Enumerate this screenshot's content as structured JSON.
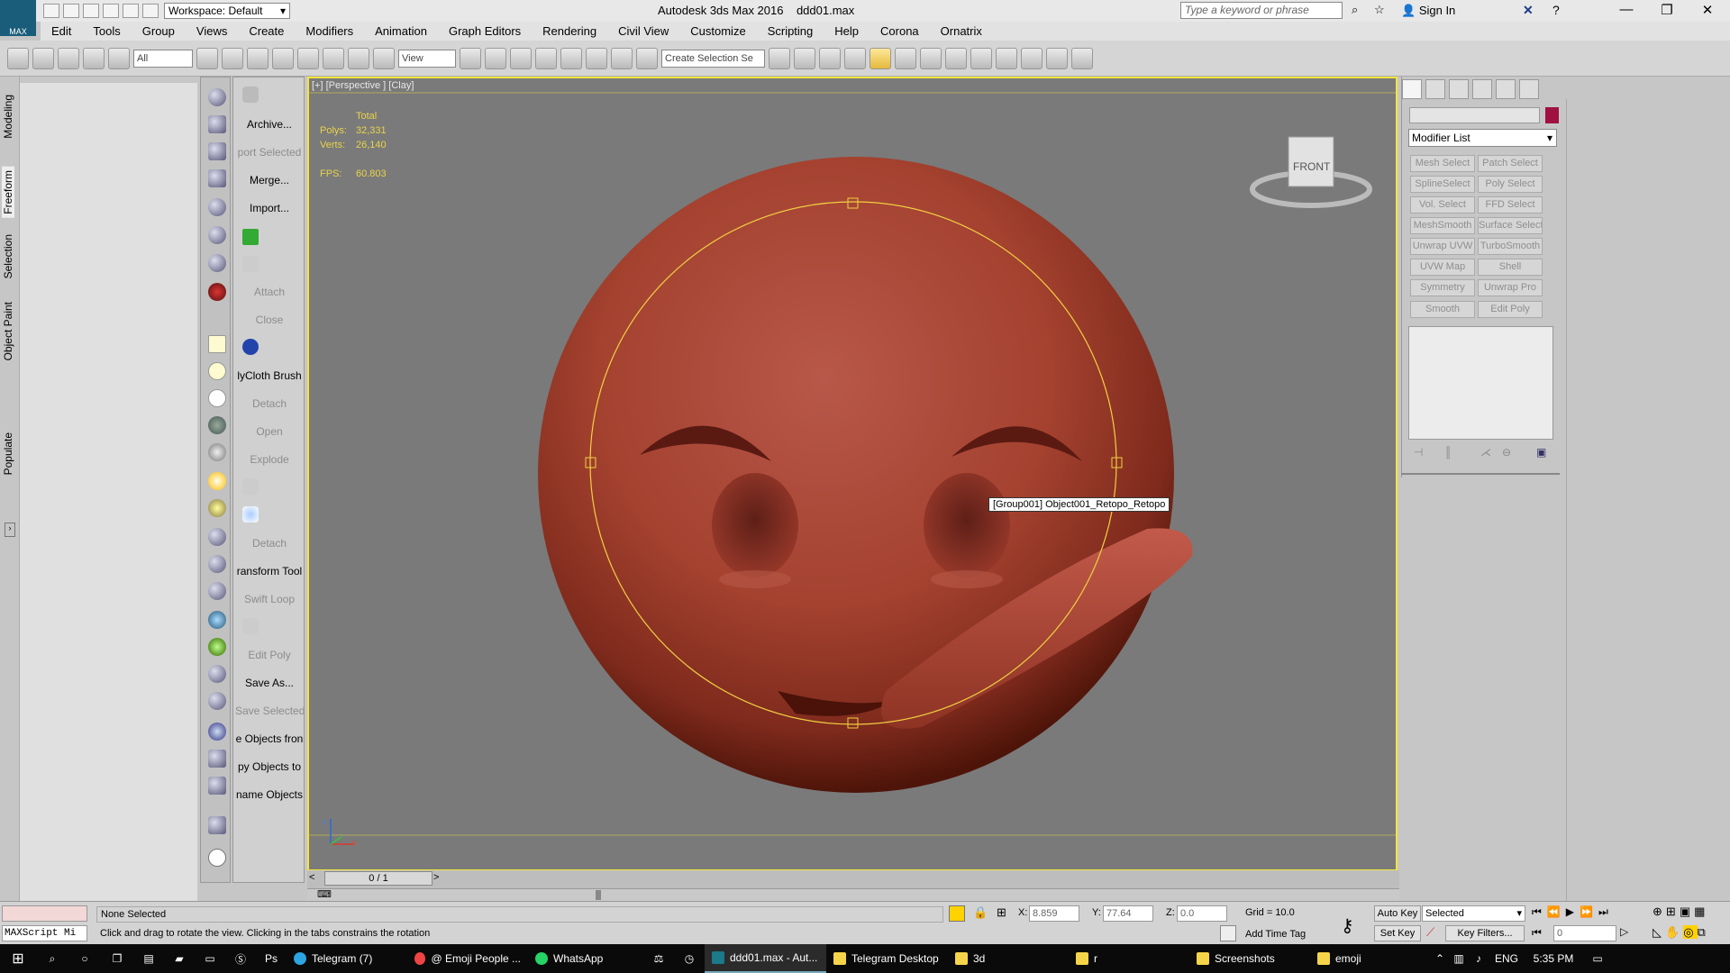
{
  "titlebar": {
    "app_title": "Autodesk 3ds Max 2016",
    "file_name": "ddd01.max",
    "workspace": "Workspace: Default",
    "search_placeholder": "Type a keyword or phrase",
    "sign_in": "Sign In",
    "logo_text": "MAX"
  },
  "menu": [
    "Edit",
    "Tools",
    "Group",
    "Views",
    "Create",
    "Modifiers",
    "Animation",
    "Graph Editors",
    "Rendering",
    "Civil View",
    "Customize",
    "Scripting",
    "Help",
    "Corona",
    "Ornatrix"
  ],
  "toolbar": {
    "filter": "All",
    "ref_coord": "View",
    "selection_set_placeholder": "Create Selection Se"
  },
  "left_tabs": [
    "Modeling",
    "Freeform",
    "Selection",
    "Object Paint",
    "Populate"
  ],
  "commands": [
    {
      "label": "Archive...",
      "enabled": true
    },
    {
      "label": "port Selected",
      "enabled": false
    },
    {
      "label": "Merge...",
      "enabled": true
    },
    {
      "label": "Import...",
      "enabled": true
    },
    {
      "label": "Attach",
      "enabled": false
    },
    {
      "label": "Close",
      "enabled": false
    },
    {
      "label": "lyCloth Brush",
      "enabled": true
    },
    {
      "label": "Detach",
      "enabled": false
    },
    {
      "label": "Open",
      "enabled": false
    },
    {
      "label": "Explode",
      "enabled": false
    },
    {
      "label": "Detach",
      "enabled": false
    },
    {
      "label": "ransform Tool",
      "enabled": true
    },
    {
      "label": "Swift Loop",
      "enabled": false
    },
    {
      "label": "Edit Poly",
      "enabled": false
    },
    {
      "label": "Save As...",
      "enabled": true
    },
    {
      "label": "Save Selected",
      "enabled": false
    },
    {
      "label": "e Objects fron",
      "enabled": true
    },
    {
      "label": "py Objects to",
      "enabled": true
    },
    {
      "label": "name Objects",
      "enabled": true
    }
  ],
  "viewport": {
    "label": "[+] [Perspective ] [Clay]",
    "stats_header": "Total",
    "polys_label": "Polys:",
    "polys": "32,331",
    "verts_label": "Verts:",
    "verts": "26,140",
    "fps_label": "FPS:",
    "fps": "60.803",
    "viewcube": "FRONT",
    "tooltip": "[Group001] Object001_Retopo_Retopo",
    "axis_x": "x",
    "axis_z": "z"
  },
  "timeslider": {
    "frame": "0 / 1"
  },
  "command_panel": {
    "modifier_list": "Modifier List",
    "buttons": [
      "Mesh Select",
      "Patch Select",
      "SplineSelect",
      "Poly Select",
      "Vol. Select",
      "FFD Select",
      "MeshSmooth",
      "Surface Select",
      "Unwrap UVW",
      "TurboSmooth",
      "UVW Map",
      "Shell",
      "Symmetry",
      "Unwrap Pro",
      "Smooth",
      "Edit Poly"
    ],
    "color_swatch": "#a01040"
  },
  "status": {
    "maxscript": "MAXScript Mi",
    "selection": "None Selected",
    "prompt": "Click and drag to rotate the view.  Clicking in the tabs constrains the rotation",
    "x_label": "X:",
    "x": "8.859",
    "y_label": "Y:",
    "y": "77.64",
    "z_label": "Z:",
    "z": "0.0",
    "grid": "Grid = 10.0",
    "add_time_tag": "Add Time Tag",
    "auto_key": "Auto Key",
    "set_key": "Set Key",
    "key_mode": "Selected",
    "key_filters": "Key Filters...",
    "current_frame": "0"
  },
  "taskbar": {
    "items": [
      "Telegram (7)",
      "@ Emoji People ...",
      "WhatsApp",
      "ddd01.max - Aut...",
      "Telegram Desktop",
      "3d",
      "r",
      "Screenshots",
      "emoji"
    ],
    "lang": "ENG",
    "time": "5:35 PM"
  }
}
